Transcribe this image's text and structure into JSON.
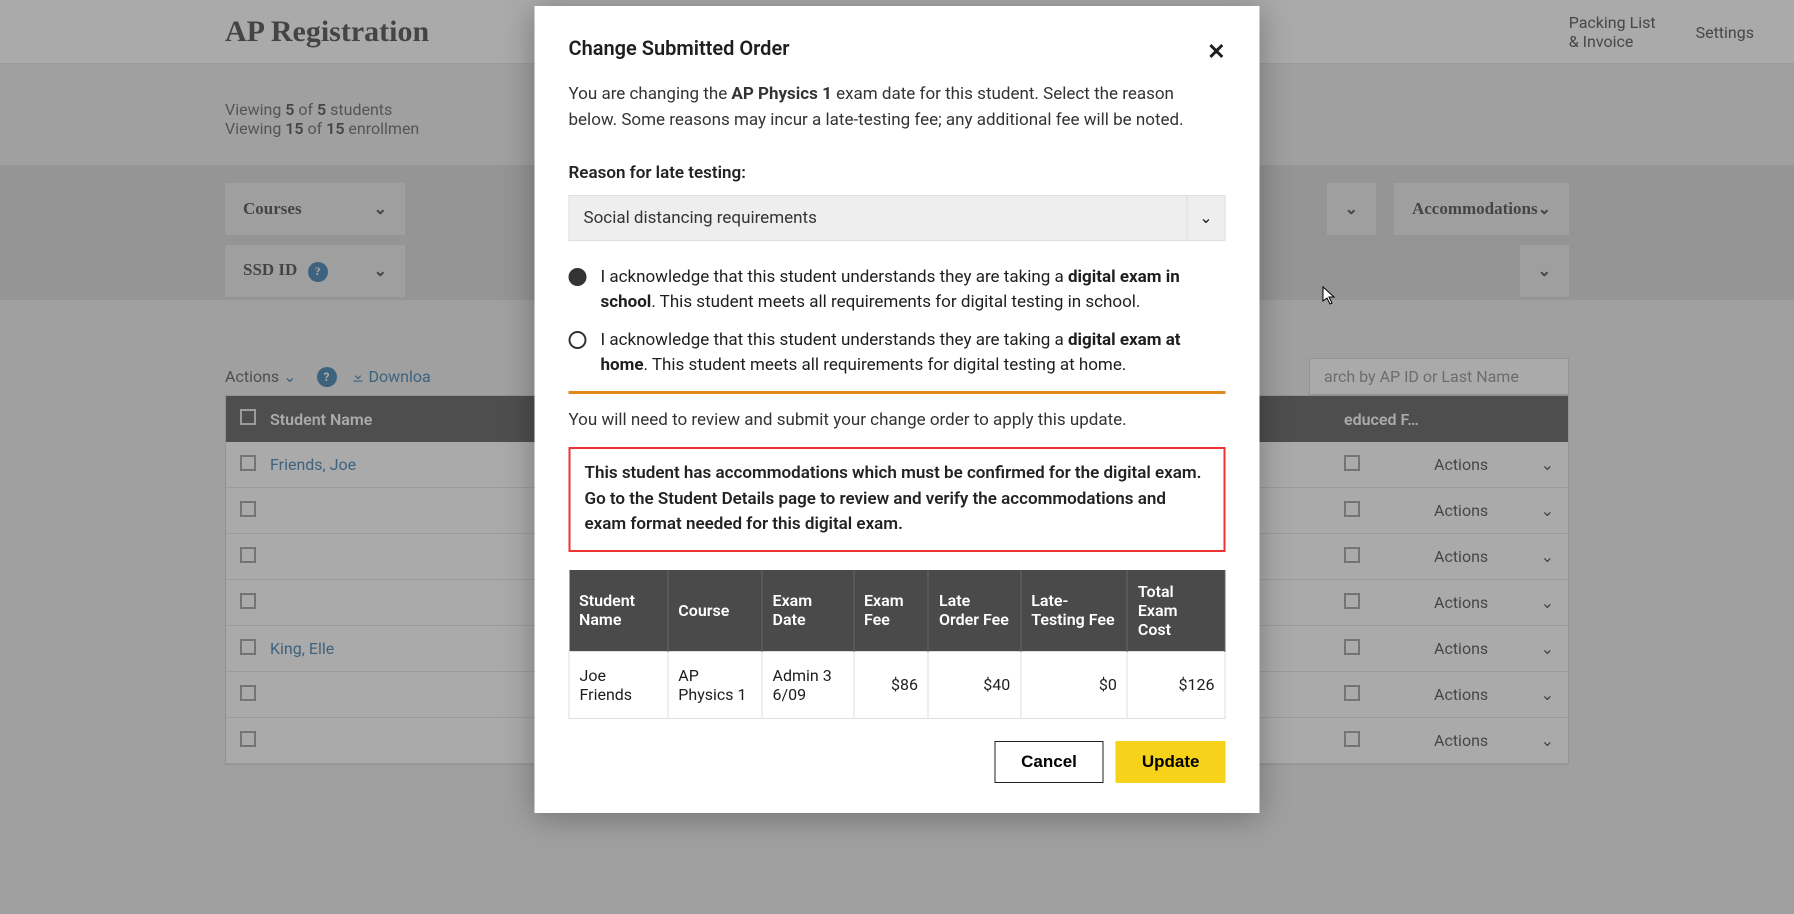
{
  "header": {
    "title": "AP Registration",
    "packing": "Packing List",
    "invoice": "& Invoice",
    "settings": "Settings"
  },
  "viewing": {
    "line1_prefix": "Viewing ",
    "line1_b1": "5",
    "line1_mid": " of ",
    "line1_b2": "5",
    "line1_suffix": " students",
    "line2_prefix": "Viewing ",
    "line2_b1": "15",
    "line2_mid": " of ",
    "line2_b2": "15",
    "line2_suffix": " enrollmen"
  },
  "filters": {
    "courses": "Courses",
    "accommodations": "Accommodations",
    "ssd": "SSD ID"
  },
  "toolbar": {
    "actions": "Actions",
    "download": "Downloa",
    "search_placeholder": "arch by AP ID or Last Name"
  },
  "table": {
    "head_name": "Student Name",
    "head_rf": "educed F…",
    "rows": [
      {
        "name": "Friends, Joe",
        "actions": "Actions"
      },
      {
        "name": "",
        "actions": "Actions"
      },
      {
        "name": "",
        "actions": "Actions"
      },
      {
        "name": "",
        "actions": "Actions"
      },
      {
        "name": "King, Elle",
        "actions": "Actions"
      },
      {
        "name": "",
        "actions": "Actions"
      },
      {
        "name": "",
        "actions": "Actions"
      }
    ]
  },
  "modal": {
    "title": "Change Submitted Order",
    "intro_pre": "You are changing the ",
    "intro_course": "AP Physics 1",
    "intro_post": " exam date for this student. Select the reason below. Some reasons may incur a late-testing fee; any additional fee will be noted.",
    "reason_label": "Reason for late testing:",
    "reason_value": "Social distancing requirements",
    "radio1_pre": "I acknowledge that this student understands they are taking a ",
    "radio1_bold": "digital exam in school",
    "radio1_post": ". This student meets all requirements for digital testing in school.",
    "radio2_pre": "I acknowledge that this student understands they are taking a ",
    "radio2_bold": "digital exam at home",
    "radio2_post": ". This student meets all requirements for digital testing at home.",
    "review_note": "You will need to review and submit your change order to apply this update.",
    "warn": "This student has accommodations which must be confirmed for the digital exam. Go to the Student Details page to review and verify the accommodations and exam format needed for this digital exam.",
    "fee_head": {
      "name": "Student Name",
      "course": "Course",
      "date": "Exam Date",
      "fee": "Exam Fee",
      "late": "Late Order Fee",
      "latetest": "Late-Testing Fee",
      "total": "Total Exam Cost"
    },
    "fee_row": {
      "name": "Joe Friends",
      "course": "AP Physics 1",
      "date": "Admin 3 6/09",
      "fee": "$86",
      "late": "$40",
      "latetest": "$0",
      "total": "$126"
    },
    "cancel": "Cancel",
    "update": "Update"
  }
}
